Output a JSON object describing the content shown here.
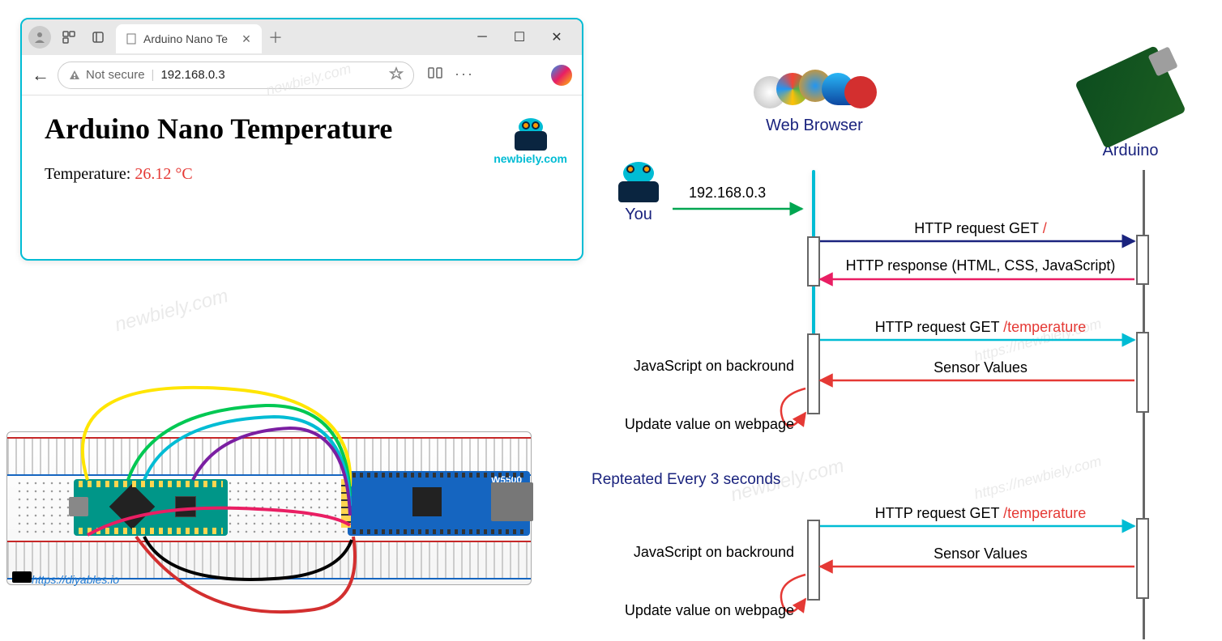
{
  "browser": {
    "tab_title": "Arduino Nano Te",
    "security_text": "Not secure",
    "url": "192.168.0.3",
    "page_heading": "Arduino Nano Temperature",
    "temp_label": "Temperature: ",
    "temp_value": "26.12 °C",
    "watermark": "newbiely.com"
  },
  "breadboard": {
    "ethernet_label": "W5500",
    "link": "https://diyables.io",
    "watermark": "newbiely.com"
  },
  "sequence": {
    "actors": {
      "you": "You",
      "browser": "Web Browser",
      "arduino": "Arduino"
    },
    "ip": "192.168.0.3",
    "msg1_a": "HTTP request GET ",
    "msg1_b": "/",
    "msg2": "HTTP response (HTML, CSS, JavaScript)",
    "msg3_a": "HTTP request GET ",
    "msg3_b": "/temperature",
    "msg4": "Sensor Values",
    "side1": "JavaScript on backround",
    "side2": "Update value on webpage",
    "repeat": "Repteated Every 3 seconds"
  },
  "watermarks": {
    "wm1": "newbiely.com",
    "wm2": "newbiely.com",
    "wm3": "https://newbiely.com"
  }
}
